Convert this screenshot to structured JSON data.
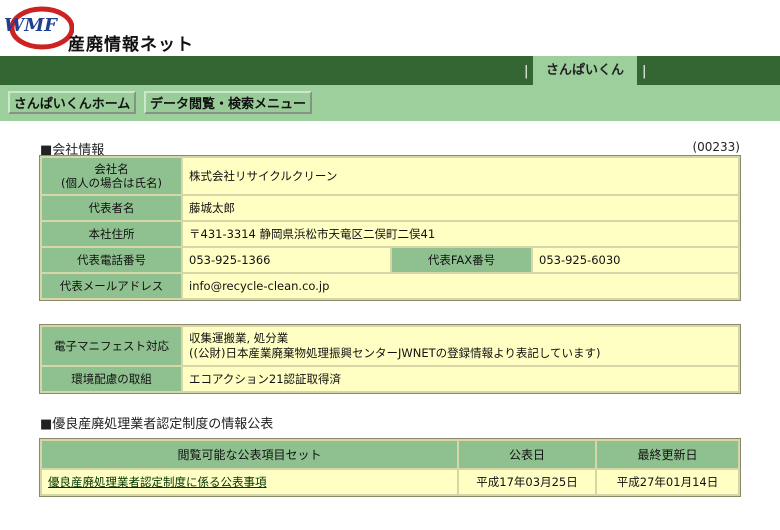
{
  "header": {
    "logo_text": "WMF",
    "title": "産廃情報ネット"
  },
  "topbar": {
    "separator": "|",
    "active_tab": "さんぱいくん"
  },
  "nav": {
    "home": "さんぱいくんホーム",
    "menu": "データ閲覧・検索メニュー"
  },
  "company": {
    "section_title": "■会社情報",
    "code": "(00233)",
    "rows": [
      {
        "label": "会社名\n(個人の場合は氏名)",
        "value": "株式会社リサイクルクリーン"
      },
      {
        "label": "代表者名",
        "value": "藤城太郎"
      },
      {
        "label": "本社住所",
        "value": "〒431-3314  静岡県浜松市天竜区二俣町二俣41"
      }
    ],
    "tel_label": "代表電話番号",
    "tel": "053-925-1366",
    "fax_label": "代表FAX番号",
    "fax": "053-925-6030",
    "email_label": "代表メールアドレス",
    "email": "info@recycle-clean.co.jp"
  },
  "manifest": {
    "label": "電子マニフェスト対応",
    "value_line1": "収集運搬業, 処分業",
    "value_line2": "((公財)日本産業廃棄物処理振興センターJWNETの登録情報より表記しています)",
    "env_label": "環境配慮の取組",
    "env_value": "エコアクション21認証取得済"
  },
  "disclosure": {
    "section_title": "■優良産廃処理業者認定制度の情報公表",
    "headers": [
      "閲覧可能な公表項目セット",
      "公表日",
      "最終更新日"
    ],
    "row": {
      "item": "優良産廃処理業者認定制度に係る公表事項",
      "published": "平成17年03月25日",
      "updated": "平成27年01月14日"
    }
  }
}
